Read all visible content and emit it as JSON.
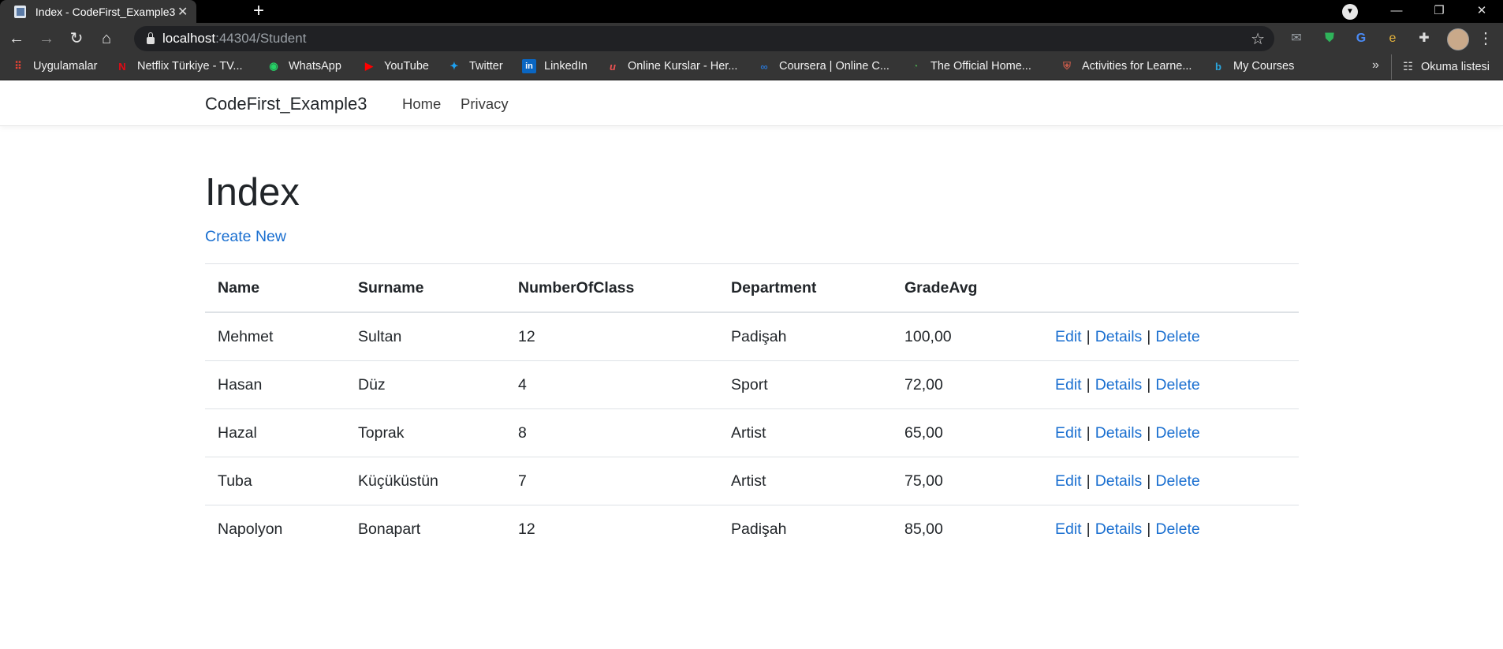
{
  "browser": {
    "tab_title": "Index - CodeFirst_Example3",
    "url_host": "localhost",
    "url_path": ":44304/Student",
    "bookmarks": [
      {
        "label": "Uygulamalar",
        "icon": "apps-grid-icon",
        "color": "#e94335"
      },
      {
        "label": "Netflix Türkiye - TV...",
        "icon": "netflix-icon",
        "color": "#e50914"
      },
      {
        "label": "WhatsApp",
        "icon": "whatsapp-icon",
        "color": "#25d366"
      },
      {
        "label": "YouTube",
        "icon": "youtube-icon",
        "color": "#ff0000"
      },
      {
        "label": "Twitter",
        "icon": "twitter-icon",
        "color": "#1da1f2"
      },
      {
        "label": "LinkedIn",
        "icon": "linkedin-icon",
        "color": "#0a66c2"
      },
      {
        "label": "Online Kurslar - Her...",
        "icon": "udemy-icon",
        "color": "#ec5252"
      },
      {
        "label": "Coursera | Online C...",
        "icon": "coursera-icon",
        "color": "#2a73cc"
      },
      {
        "label": "The Official Home...",
        "icon": "official-home-icon",
        "color": "#4caf50"
      },
      {
        "label": "Activities for Learne...",
        "icon": "shield-crest-icon",
        "color": "#c25a4a"
      },
      {
        "label": "My Courses",
        "icon": "bing-icon",
        "color": "#2aa6de"
      }
    ],
    "reading_list": "Okuma listesi"
  },
  "site": {
    "brand": "CodeFirst_Example3",
    "nav": [
      "Home",
      "Privacy"
    ]
  },
  "main": {
    "title": "Index",
    "create_link": "Create New",
    "columns": [
      "Name",
      "Surname",
      "NumberOfClass",
      "Department",
      "GradeAvg"
    ],
    "rows": [
      [
        "Mehmet",
        "Sultan",
        "12",
        "Padişah",
        "100,00"
      ],
      [
        "Hasan",
        "Düz",
        "4",
        "Sport",
        "72,00"
      ],
      [
        "Hazal",
        "Toprak",
        "8",
        "Artist",
        "65,00"
      ],
      [
        "Tuba",
        "Küçüküstün",
        "7",
        "Artist",
        "75,00"
      ],
      [
        "Napolyon",
        "Bonapart",
        "12",
        "Padişah",
        "85,00"
      ]
    ],
    "actions": {
      "edit": "Edit",
      "details": "Details",
      "delete": "Delete",
      "separator": "|"
    }
  },
  "colors": {
    "link": "#1a6fd0",
    "text": "#212529"
  }
}
